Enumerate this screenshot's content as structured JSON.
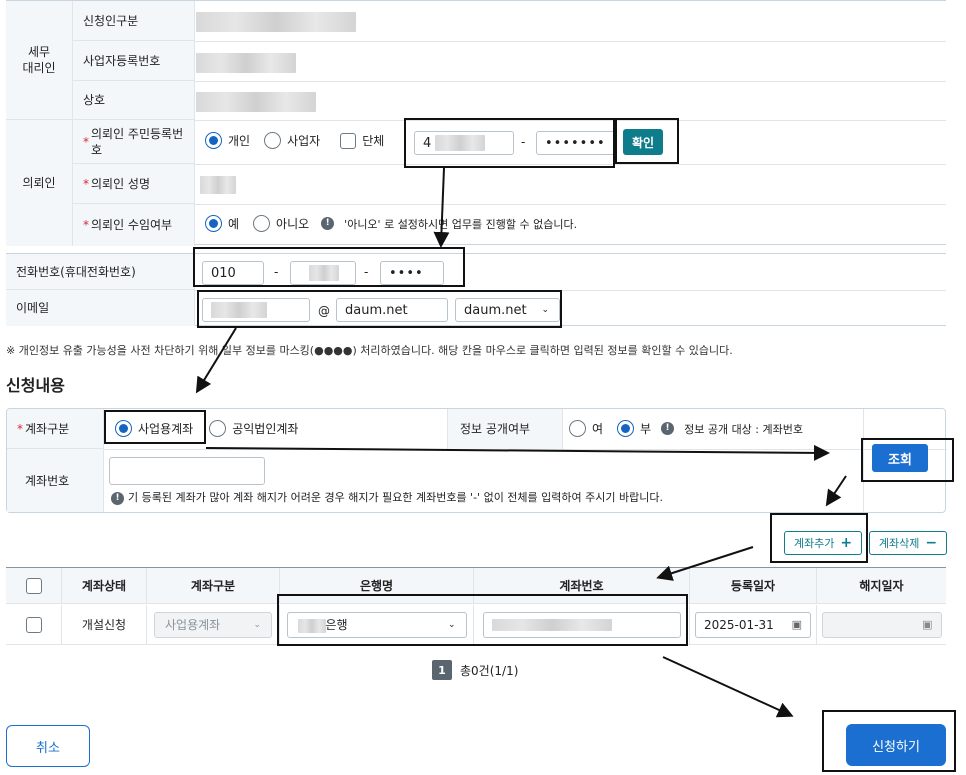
{
  "agent": {
    "group": "세무\n대리인",
    "type_label": "신청인구분",
    "bizno_label": "사업자등록번호",
    "name_label": "상호"
  },
  "client": {
    "group": "의뢰인",
    "rrn_label": "의뢰인 주민등록번\n호",
    "opt_individual": "개인",
    "opt_business": "사업자",
    "opt_group": "단체",
    "rrn_prefix": "4",
    "rrn_mask": "•••••••",
    "confirm_btn": "확인",
    "name_label": "의뢰인 성명",
    "accept_label": "의뢰인 수임여부",
    "accept_yes": "예",
    "accept_no": "아니오",
    "accept_note": "'아니오' 로 설정하시면 업무를 진행할 수 없습니다."
  },
  "contact": {
    "phone_label": "전화번호(휴대전화번호)",
    "phone1": "010",
    "phone3": "••••",
    "email_label": "이메일",
    "email_at": "@",
    "email_domain": "daum.net",
    "email_select": "daum.net"
  },
  "notice": "※ 개인정보 유출 가능성을 사전 차단하기 위해 일부 정보를 마스킹(●●●●) 처리하였습니다. 해당 칸을 마우스로 클릭하면 입력된 정보를 확인할 수 있습니다.",
  "section_title": "신청내용",
  "account": {
    "type_label": "계좌구분",
    "opt_business": "사업용계좌",
    "opt_public": "공익법인계좌",
    "disclose_label": "정보 공개여부",
    "disclose_yes": "여",
    "disclose_no": "부",
    "disclose_note": "정보 공개 대상 : 계좌번호",
    "search_btn": "조회",
    "no_label": "계좌번호",
    "no_help": "기 등록된 계좌가 많아 계좌 해지가 어려운 경우 해지가 필요한 계좌번호를 '-' 없이 전체를 입력하여 주시기 바랍니다."
  },
  "buttons": {
    "add": "계좌추가",
    "del": "계좌삭제",
    "cancel": "취소",
    "submit": "신청하기"
  },
  "grid": {
    "headers": [
      "계좌상태",
      "계좌구분",
      "은행명",
      "계좌번호",
      "등록일자",
      "해지일자"
    ],
    "row": {
      "status": "개설신청",
      "type": "사업용계좌",
      "bank": "은행",
      "date": "2025-01-31"
    }
  },
  "pagination": {
    "page": "1",
    "total": "총0건(1/1)"
  }
}
